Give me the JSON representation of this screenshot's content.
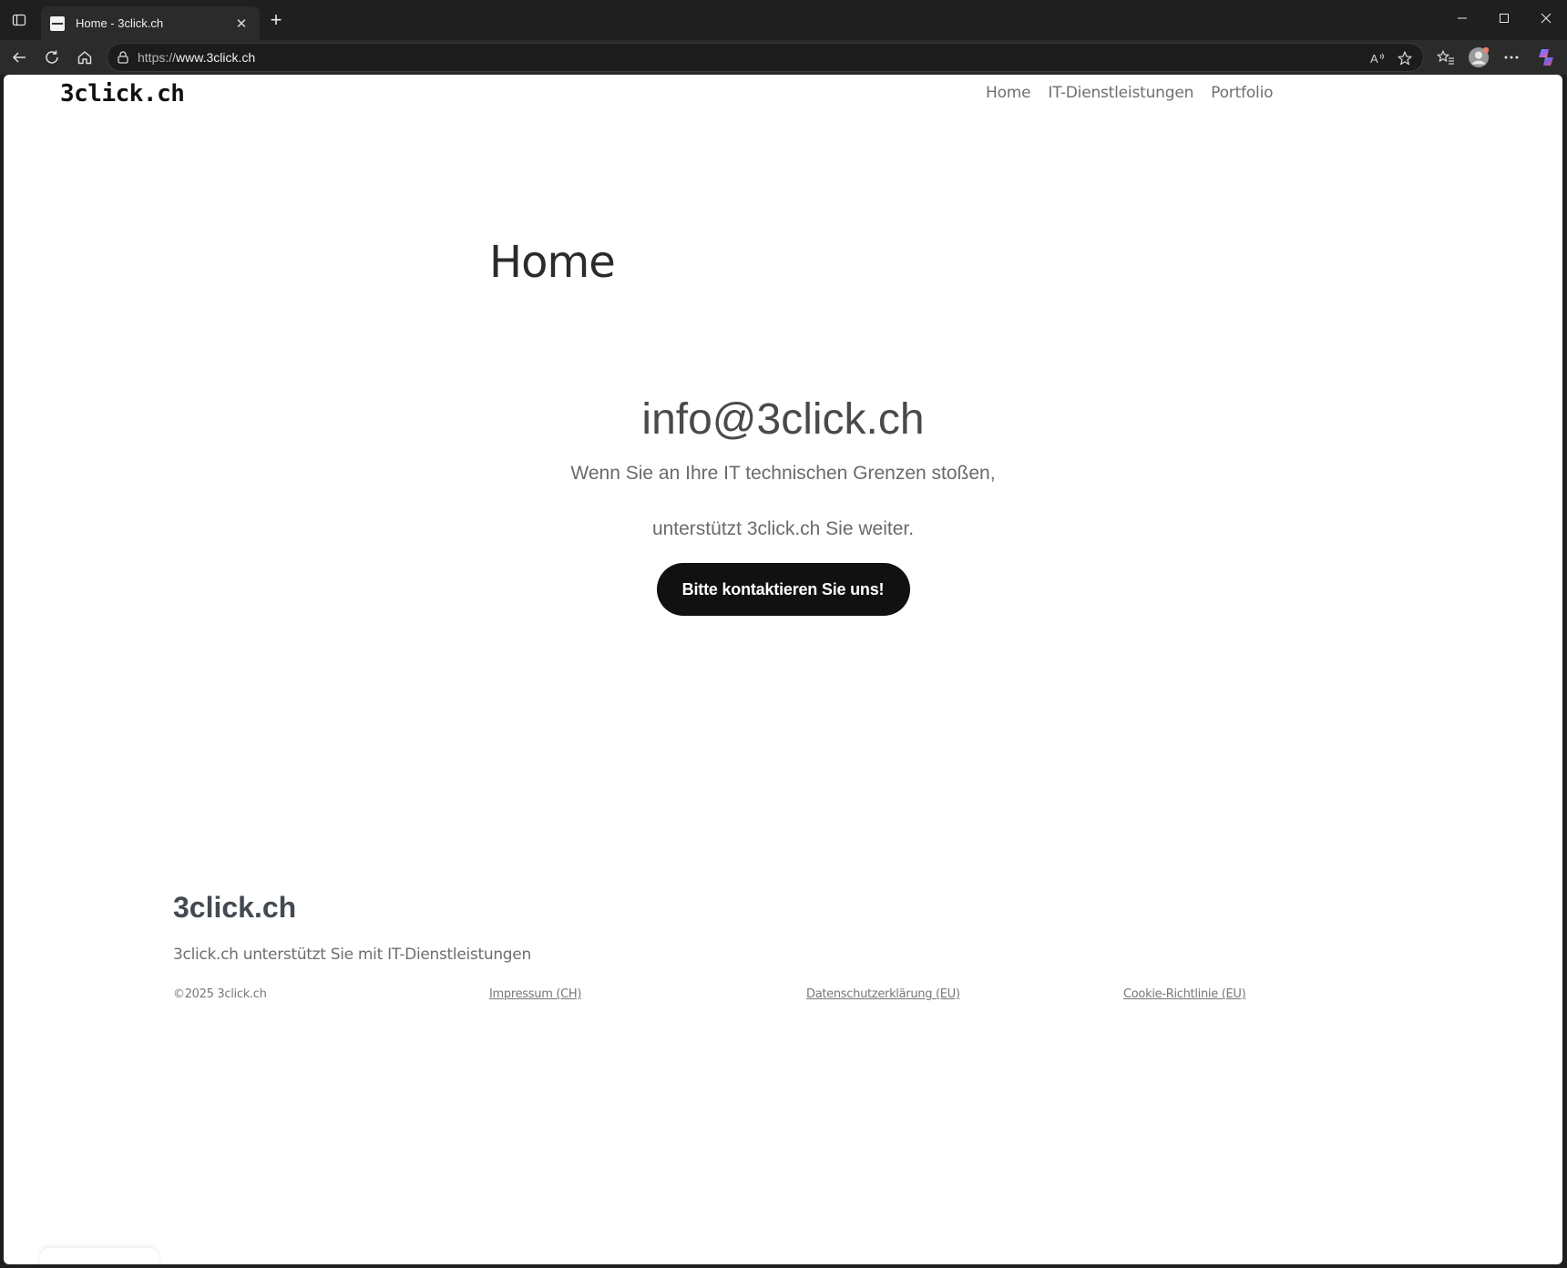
{
  "browser": {
    "tab_title": "Home - 3click.ch",
    "tab_close": "✕",
    "new_tab": "+",
    "url_scheme": "https://",
    "url_host": "www.3click.ch"
  },
  "site": {
    "logo": "3click.ch",
    "nav": [
      "Home",
      "IT-Dienstleistungen",
      "Portfolio"
    ],
    "page_title": "Home",
    "hero": {
      "email": "info@3click.ch",
      "line1": "Wenn Sie an Ihre IT technischen Grenzen stoßen,",
      "line2": "unterstützt 3click.ch Sie weiter.",
      "cta": "Bitte kontaktieren Sie uns!"
    },
    "footer": {
      "logo": "3click.ch",
      "tagline": "3click.ch unterstützt Sie mit IT-Dienstleistungen",
      "copyright": "©2025 3click.ch",
      "links": [
        "Impressum (CH)",
        "Datenschutzerklärung (EU)",
        "Cookie-Richtlinie (EU)"
      ]
    }
  }
}
